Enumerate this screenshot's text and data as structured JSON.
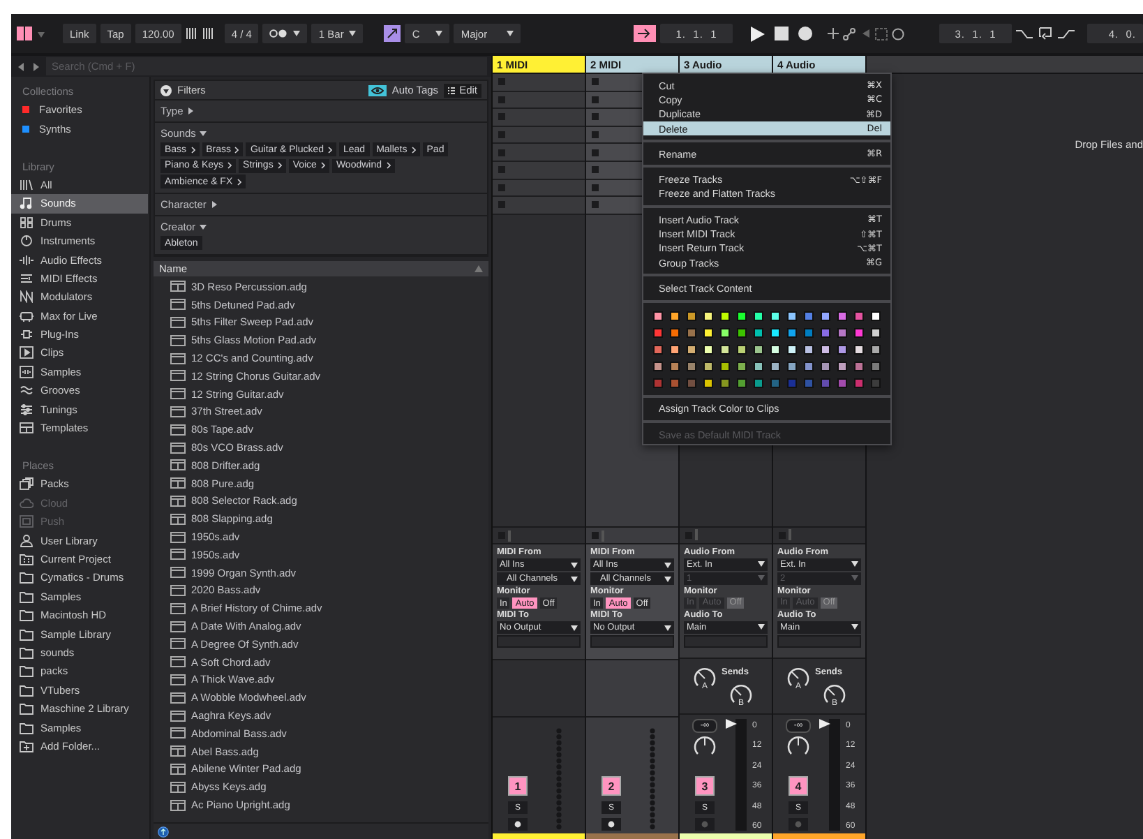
{
  "transport": {
    "link": "Link",
    "tap": "Tap",
    "tempo": "120.00",
    "signature": "4 / 4",
    "quantize": "1 Bar",
    "key": "C",
    "scale": "Major",
    "position": "1.  1.  1",
    "loop_start": "3.  1.  1",
    "loop_length": "4.  0."
  },
  "browser": {
    "search": {
      "placeholder": "Search (Cmd + F)"
    },
    "collections_heading": "Collections",
    "collections": [
      {
        "label": "Favorites",
        "color": "#ff2a2a"
      },
      {
        "label": "Synths",
        "color": "#1e90ff"
      }
    ],
    "library_heading": "Library",
    "library": [
      {
        "label": "All",
        "selected": false
      },
      {
        "label": "Sounds",
        "selected": true
      },
      {
        "label": "Drums",
        "selected": false
      },
      {
        "label": "Instruments",
        "selected": false
      },
      {
        "label": "Audio Effects",
        "selected": false
      },
      {
        "label": "MIDI Effects",
        "selected": false
      },
      {
        "label": "Modulators",
        "selected": false
      },
      {
        "label": "Max for Live",
        "selected": false
      },
      {
        "label": "Plug-Ins",
        "selected": false
      },
      {
        "label": "Clips",
        "selected": false
      },
      {
        "label": "Samples",
        "selected": false
      },
      {
        "label": "Grooves",
        "selected": false
      },
      {
        "label": "Tunings",
        "selected": false
      },
      {
        "label": "Templates",
        "selected": false
      }
    ],
    "places_heading": "Places",
    "places": [
      {
        "label": "Packs",
        "disabled": false
      },
      {
        "label": "Cloud",
        "disabled": true
      },
      {
        "label": "Push",
        "disabled": true
      },
      {
        "label": "User Library",
        "disabled": false
      },
      {
        "label": "Current Project",
        "disabled": false
      },
      {
        "label": "Cymatics - Drums",
        "disabled": false
      },
      {
        "label": "Samples",
        "disabled": false
      },
      {
        "label": "Macintosh HD",
        "disabled": false
      },
      {
        "label": "Sample Library",
        "disabled": false
      },
      {
        "label": "sounds",
        "disabled": false
      },
      {
        "label": "packs",
        "disabled": false
      },
      {
        "label": "VTubers",
        "disabled": false
      },
      {
        "label": "Maschine 2 Library",
        "disabled": false
      },
      {
        "label": "Samples",
        "disabled": false
      },
      {
        "label": "Add Folder...",
        "disabled": false
      }
    ],
    "filters": {
      "title": "Filters",
      "auto_tags": {
        "label": "Auto Tags",
        "on": true
      },
      "edit": "Edit",
      "sections": [
        {
          "label": "Type",
          "expanded": false
        },
        {
          "label": "Sounds",
          "expanded": true,
          "tags": [
            {
              "label": "Bass",
              "expandable": true
            },
            {
              "label": "Brass",
              "expandable": true
            },
            {
              "label": "Guitar & Plucked",
              "expandable": true
            },
            {
              "label": "Lead",
              "expandable": false
            },
            {
              "label": "Mallets",
              "expandable": true
            },
            {
              "label": "Pad",
              "expandable": false
            },
            {
              "label": "Piano & Keys",
              "expandable": true
            },
            {
              "label": "Strings",
              "expandable": true
            },
            {
              "label": "Voice",
              "expandable": true
            },
            {
              "label": "Woodwind",
              "expandable": true
            },
            {
              "label": "Ambience & FX",
              "expandable": true
            }
          ]
        },
        {
          "label": "Character",
          "expanded": false
        },
        {
          "label": "Creator",
          "expanded": true,
          "tags": [
            {
              "label": "Ableton",
              "expandable": false
            }
          ]
        }
      ]
    },
    "files": {
      "column": "Name",
      "items": [
        {
          "name": "3D Reso Percussion.adg",
          "kind": "rack"
        },
        {
          "name": "5ths Detuned Pad.adv",
          "kind": "preset"
        },
        {
          "name": "5ths Filter Sweep Pad.adv",
          "kind": "preset"
        },
        {
          "name": "5ths Glass Motion Pad.adv",
          "kind": "preset"
        },
        {
          "name": "12 CC's and Counting.adv",
          "kind": "preset"
        },
        {
          "name": "12 String Chorus Guitar.adv",
          "kind": "preset"
        },
        {
          "name": "12 String Guitar.adv",
          "kind": "preset"
        },
        {
          "name": "37th Street.adv",
          "kind": "preset"
        },
        {
          "name": "80s Tape.adv",
          "kind": "preset"
        },
        {
          "name": "80s VCO Brass.adv",
          "kind": "preset"
        },
        {
          "name": "808 Drifter.adg",
          "kind": "rack"
        },
        {
          "name": "808 Pure.adg",
          "kind": "rack"
        },
        {
          "name": "808 Selector Rack.adg",
          "kind": "rack"
        },
        {
          "name": "808 Slapping.adg",
          "kind": "rack"
        },
        {
          "name": "1950s.adv",
          "kind": "preset"
        },
        {
          "name": "1950s.adv",
          "kind": "preset"
        },
        {
          "name": "1999 Organ Synth.adv",
          "kind": "preset"
        },
        {
          "name": "2020 Bass.adv",
          "kind": "preset"
        },
        {
          "name": "A Brief History of Chime.adv",
          "kind": "preset"
        },
        {
          "name": "A Date With Analog.adv",
          "kind": "preset"
        },
        {
          "name": "A Degree Of Synth.adv",
          "kind": "preset"
        },
        {
          "name": "A Soft Chord.adv",
          "kind": "preset"
        },
        {
          "name": "A Thick Wave.adv",
          "kind": "preset"
        },
        {
          "name": "A Wobble Modwheel.adv",
          "kind": "preset"
        },
        {
          "name": "Aaghra Keys.adv",
          "kind": "preset"
        },
        {
          "name": "Abdominal Bass.adv",
          "kind": "preset"
        },
        {
          "name": "Abel Bass.adg",
          "kind": "rack"
        },
        {
          "name": "Abilene Winter Pad.adg",
          "kind": "rack"
        },
        {
          "name": "Abyss Keys.adg",
          "kind": "rack"
        },
        {
          "name": "Ac Piano Upright.adg",
          "kind": "rack"
        }
      ]
    }
  },
  "session": {
    "drop_hint": "Drop Files and",
    "tracks": [
      {
        "name": "1 MIDI",
        "kind": "midi",
        "color": "#fff034",
        "selected": false,
        "active": false,
        "input_label": "MIDI From",
        "input": "All Ins",
        "channel": "All Channels",
        "channel_disabled": false,
        "monitor_label": "Monitor",
        "monitor_disabled": false,
        "monitor": [
          {
            "label": "In",
            "selected": false
          },
          {
            "label": "Auto",
            "selected": true
          },
          {
            "label": "Off",
            "selected": false
          }
        ],
        "output_label": "MIDI To",
        "output": "No Output",
        "number": "1",
        "solo": "S"
      },
      {
        "name": "2 MIDI",
        "kind": "midi",
        "color": "#99724b",
        "selected": true,
        "active": true,
        "input_label": "MIDI From",
        "input": "All Ins",
        "channel": "All Channels",
        "channel_disabled": false,
        "monitor_label": "Monitor",
        "monitor_disabled": false,
        "monitor": [
          {
            "label": "In",
            "selected": false
          },
          {
            "label": "Auto",
            "selected": true
          },
          {
            "label": "Off",
            "selected": false
          }
        ],
        "output_label": "MIDI To",
        "output": "No Output",
        "number": "2",
        "solo": "S"
      },
      {
        "name": "3 Audio",
        "kind": "audio",
        "color": "#edffae",
        "selected": true,
        "active": false,
        "input_label": "Audio From",
        "input": "Ext. In",
        "channel": "1",
        "channel_disabled": true,
        "monitor_label": "Monitor",
        "monitor_disabled": true,
        "monitor": [
          {
            "label": "In",
            "selected": false
          },
          {
            "label": "Auto",
            "selected": false
          },
          {
            "label": "Off",
            "selected": true
          }
        ],
        "output_label": "Audio To",
        "output": "Main",
        "sends_label": "Sends",
        "sends": [
          "A",
          "B"
        ],
        "volume": "-∞",
        "level": 1,
        "scale": [
          "0",
          "12",
          "24",
          "36",
          "48",
          "60"
        ],
        "number": "3",
        "solo": "S"
      },
      {
        "name": "4 Audio",
        "kind": "audio",
        "color": "#ffa529",
        "selected": true,
        "active": false,
        "input_label": "Audio From",
        "input": "Ext. In",
        "channel": "2",
        "channel_disabled": true,
        "monitor_label": "Monitor",
        "monitor_disabled": true,
        "monitor": [
          {
            "label": "In",
            "selected": false
          },
          {
            "label": "Auto",
            "selected": false
          },
          {
            "label": "Off",
            "selected": true
          }
        ],
        "output_label": "Audio To",
        "output": "Main",
        "sends_label": "Sends",
        "sends": [
          "A",
          "B"
        ],
        "volume": "-∞",
        "level": 1,
        "scale": [
          "0",
          "12",
          "24",
          "36",
          "48",
          "60"
        ],
        "number": "4",
        "solo": "S"
      }
    ]
  },
  "context_menu": {
    "sections": [
      {
        "kind": "items",
        "items": [
          {
            "label": "Cut",
            "shortcut": "⌘X",
            "selected": false,
            "disabled": false
          },
          {
            "label": "Copy",
            "shortcut": "⌘C",
            "selected": false,
            "disabled": false
          },
          {
            "label": "Duplicate",
            "shortcut": "⌘D",
            "selected": false,
            "disabled": false
          },
          {
            "label": "Delete",
            "shortcut": "Del",
            "selected": true,
            "disabled": false
          }
        ]
      },
      {
        "kind": "items",
        "items": [
          {
            "label": "Rename",
            "shortcut": "⌘R",
            "selected": false,
            "disabled": false
          }
        ]
      },
      {
        "kind": "items",
        "items": [
          {
            "label": "Freeze Tracks",
            "shortcut": "⌥⇧⌘F",
            "selected": false,
            "disabled": false
          },
          {
            "label": "Freeze and Flatten Tracks",
            "selected": false,
            "disabled": false
          }
        ]
      },
      {
        "kind": "items",
        "items": [
          {
            "label": "Insert Audio Track",
            "shortcut": "⌘T",
            "selected": false,
            "disabled": false
          },
          {
            "label": "Insert MIDI Track",
            "shortcut": "⇧⌘T",
            "selected": false,
            "disabled": false
          },
          {
            "label": "Insert Return Track",
            "shortcut": "⌥⌘T",
            "selected": false,
            "disabled": false
          },
          {
            "label": "Group Tracks",
            "shortcut": "⌘G",
            "selected": false,
            "disabled": false
          }
        ]
      },
      {
        "kind": "items",
        "items": [
          {
            "label": "Select Track Content",
            "selected": false,
            "disabled": false
          }
        ]
      },
      {
        "kind": "palette",
        "rows": [
          [
            {
              "color": "#ff94a6"
            },
            {
              "color": "#ffa529"
            },
            {
              "color": "#cc9927"
            },
            {
              "color": "#f7f47c"
            },
            {
              "color": "#bffb00"
            },
            {
              "color": "#1aff2f"
            },
            {
              "color": "#25ffa8"
            },
            {
              "color": "#5cffe8"
            },
            {
              "color": "#8bc5ff"
            },
            {
              "color": "#5480e4"
            },
            {
              "color": "#92a7ff"
            },
            {
              "color": "#d86ce4"
            },
            {
              "color": "#e553a0"
            },
            {
              "color": "#ffffff"
            }
          ],
          [
            {
              "color": "#ff3636"
            },
            {
              "color": "#f66c03"
            },
            {
              "color": "#99724b"
            },
            {
              "color": "#fff034"
            },
            {
              "color": "#87ff67"
            },
            {
              "color": "#3dc300"
            },
            {
              "color": "#00bfaf"
            },
            {
              "color": "#19e9ff"
            },
            {
              "color": "#10a4ee"
            },
            {
              "color": "#007dc0"
            },
            {
              "color": "#886ce4"
            },
            {
              "color": "#b677c6"
            },
            {
              "color": "#ff39d4"
            },
            {
              "color": "#d0d0d0"
            }
          ],
          [
            {
              "color": "#e2675a"
            },
            {
              "color": "#ffa374"
            },
            {
              "color": "#d3ad71"
            },
            {
              "color": "#edffae"
            },
            {
              "color": "#d2e498"
            },
            {
              "color": "#bad074"
            },
            {
              "color": "#9bc48d"
            },
            {
              "color": "#d4fde1"
            },
            {
              "color": "#cdf1f8"
            },
            {
              "color": "#b9c1e3"
            },
            {
              "color": "#cdbbe4"
            },
            {
              "color": "#ae98e5"
            },
            {
              "color": "#e5dce1"
            },
            {
              "color": "#a9a9a9"
            }
          ],
          [
            {
              "color": "#c6928b"
            },
            {
              "color": "#b78256"
            },
            {
              "color": "#99836a"
            },
            {
              "color": "#bfba69"
            },
            {
              "color": "#a6be00"
            },
            {
              "color": "#7db04d"
            },
            {
              "color": "#88c2ba"
            },
            {
              "color": "#9bb3c4"
            },
            {
              "color": "#85a5c2"
            },
            {
              "color": "#8393cc"
            },
            {
              "color": "#a595b5"
            },
            {
              "color": "#bf9fbe"
            },
            {
              "color": "#bc7196"
            },
            {
              "color": "#7b7b7b"
            }
          ],
          [
            {
              "color": "#af3333"
            },
            {
              "color": "#a95131"
            },
            {
              "color": "#724f41"
            },
            {
              "color": "#dbc300"
            },
            {
              "color": "#85961f"
            },
            {
              "color": "#539f31"
            },
            {
              "color": "#0a9c8e"
            },
            {
              "color": "#236384"
            },
            {
              "color": "#1a2f96"
            },
            {
              "color": "#2f52a2"
            },
            {
              "color": "#624bad"
            },
            {
              "color": "#a34bad"
            },
            {
              "color": "#cc2e6e"
            },
            {
              "color": "#3c3c3c"
            }
          ]
        ]
      },
      {
        "kind": "items",
        "items": [
          {
            "label": "Assign Track Color to Clips",
            "selected": false,
            "disabled": false
          }
        ]
      },
      {
        "kind": "items",
        "items": [
          {
            "label": "Save as Default MIDI Track",
            "selected": false,
            "disabled": true
          }
        ]
      }
    ]
  }
}
